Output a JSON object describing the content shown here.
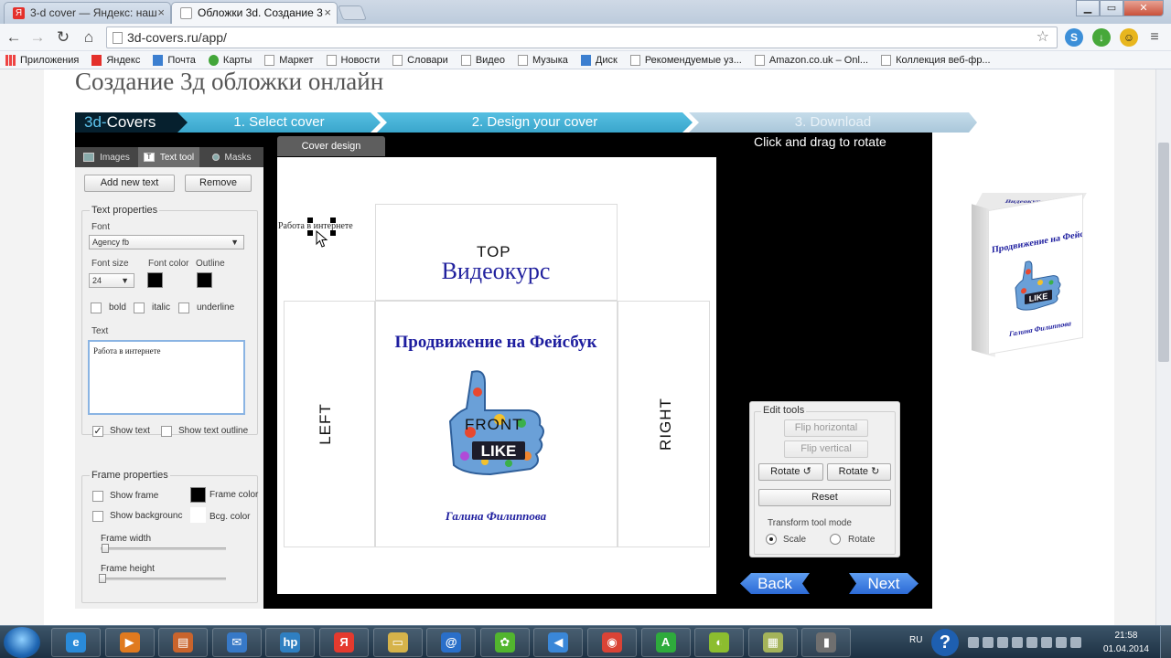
{
  "browser": {
    "tabs": [
      {
        "label": "3-d cover — Яндекс: наш",
        "favicon": "yandex-icon",
        "color": "#e4302b"
      },
      {
        "label": "Обложки 3d. Создание 3",
        "favicon": "page-icon",
        "color": "#2f6fb1"
      }
    ],
    "window_buttons": {
      "minimize": "▁",
      "maximize": "▭",
      "close": "✕"
    },
    "nav": {
      "back": "←",
      "forward": "→",
      "reload": "↻",
      "home": "⌂"
    },
    "url": "3d-covers.ru/app/",
    "star": "☆",
    "bookmarks": [
      {
        "label": "Приложения",
        "icon": "apps-grid-icon"
      },
      {
        "label": "Яндекс",
        "icon": "yandex-icon"
      },
      {
        "label": "Почта",
        "icon": "mail-icon"
      },
      {
        "label": "Карты",
        "icon": "maps-icon"
      },
      {
        "label": "Маркет",
        "icon": "page-icon"
      },
      {
        "label": "Новости",
        "icon": "page-icon"
      },
      {
        "label": "Словари",
        "icon": "page-icon"
      },
      {
        "label": "Видео",
        "icon": "page-icon"
      },
      {
        "label": "Музыка",
        "icon": "page-icon"
      },
      {
        "label": "Диск",
        "icon": "disk-icon"
      },
      {
        "label": "Рекомендуемые уз...",
        "icon": "page-icon"
      },
      {
        "label": "Amazon.co.uk – Onl...",
        "icon": "page-icon"
      },
      {
        "label": "Коллекция веб-фр...",
        "icon": "page-icon"
      }
    ]
  },
  "page": {
    "title": "Создание 3д обложки онлайн",
    "logo": {
      "prefix": "3d-",
      "name": "Covers"
    },
    "steps": [
      "1. Select cover",
      "2. Design your cover",
      "3. Download"
    ]
  },
  "left_panel": {
    "tabs": [
      {
        "label": "Images",
        "icon": "image-icon"
      },
      {
        "label": "Text tool",
        "icon": "text-tool-icon",
        "active": true
      },
      {
        "label": "Masks",
        "icon": "mask-icon"
      }
    ],
    "add_button": "Add new text",
    "remove_button": "Remove",
    "text_properties": {
      "legend": "Text properties",
      "font_label": "Font",
      "font_value": "Agency fb",
      "font_size_label": "Font size",
      "font_size_value": "24",
      "font_color_label": "Font color",
      "font_color": "#000000",
      "outline_label": "Outline",
      "outline_color": "#000000",
      "bold_label": "bold",
      "italic_label": "italic",
      "underline_label": "underline",
      "text_label": "Text",
      "text_value": "Работа в интернете",
      "show_text_label": "Show text",
      "show_text_checked": true,
      "show_outline_label": "Show text outline"
    },
    "frame_properties": {
      "legend": "Frame properties",
      "show_frame_label": "Show frame",
      "frame_color_label": "Frame color",
      "frame_color": "#000000",
      "show_background_label": "Show backgrounc",
      "bcg_color_label": "Bcg. color",
      "bcg_color": "#ffffff",
      "frame_width_label": "Frame width",
      "frame_height_label": "Frame height"
    }
  },
  "editor": {
    "tab_label": "Cover design",
    "floating_text": "Работа в интернете",
    "faces": {
      "top": {
        "label": "TOP",
        "text": "Видеокурс"
      },
      "left": {
        "label": "LEFT"
      },
      "right": {
        "label": "RIGHT"
      },
      "front": {
        "label": "FRONT",
        "title": "Продвижение на Фейсбук",
        "badge": "LIKE",
        "author": "Галина Филиппова"
      }
    },
    "rotate_hint": "Click and drag to rotate"
  },
  "edit_tools": {
    "legend": "Edit tools",
    "flip_horizontal": "Flip horizontal",
    "flip_vertical": "Flip vertical",
    "rotate_ccw": "Rotate",
    "rotate_cw": "Rotate",
    "rotate_ccw_glyph": "↺",
    "rotate_cw_glyph": "↻",
    "reset": "Reset",
    "mode_label": "Transform tool mode",
    "scale_label": "Scale",
    "rotate_label": "Rotate",
    "selected_mode": "Scale"
  },
  "nav_buttons": {
    "back": "Back",
    "next": "Next"
  },
  "preview": {
    "top_text": "Видеокурс",
    "title": "Продвижение на Фейсбук",
    "badge": "LIKE",
    "author": "Галина Филиппова"
  },
  "taskbar": {
    "apps": [
      {
        "name": "ie-icon",
        "glyph": "e",
        "color": "#2a8ad8"
      },
      {
        "name": "media-player-icon",
        "glyph": "▶",
        "color": "#e07a1f"
      },
      {
        "name": "presentation-icon",
        "glyph": "▤",
        "color": "#c9642c"
      },
      {
        "name": "email-icon",
        "glyph": "✉",
        "color": "#3779c7"
      },
      {
        "name": "hp-icon",
        "glyph": "hp",
        "color": "#2f7fc1"
      },
      {
        "name": "yandex-browser-icon",
        "glyph": "Я",
        "color": "#e43a2e"
      },
      {
        "name": "folder-icon",
        "glyph": "▭",
        "color": "#d6b34a"
      },
      {
        "name": "mail-agent-icon",
        "glyph": "@",
        "color": "#2a6fc9"
      },
      {
        "name": "icq-icon",
        "glyph": "✿",
        "color": "#52b52e"
      },
      {
        "name": "speaker-icon",
        "glyph": "◀",
        "color": "#3a87d8"
      },
      {
        "name": "chrome-icon",
        "glyph": "◉",
        "color": "#d94336"
      },
      {
        "name": "green-a-icon",
        "glyph": "A",
        "color": "#2eab3c"
      },
      {
        "name": "graphics-icon",
        "glyph": "◐",
        "color": "#8cbd2f"
      },
      {
        "name": "notes-icon",
        "glyph": "▦",
        "color": "#a4b35a"
      },
      {
        "name": "camera-icon",
        "glyph": "▮",
        "color": "#6f6f6f"
      }
    ],
    "language": "RU",
    "help_glyph": "?",
    "time": "21:58",
    "date": "01.04.2014"
  }
}
